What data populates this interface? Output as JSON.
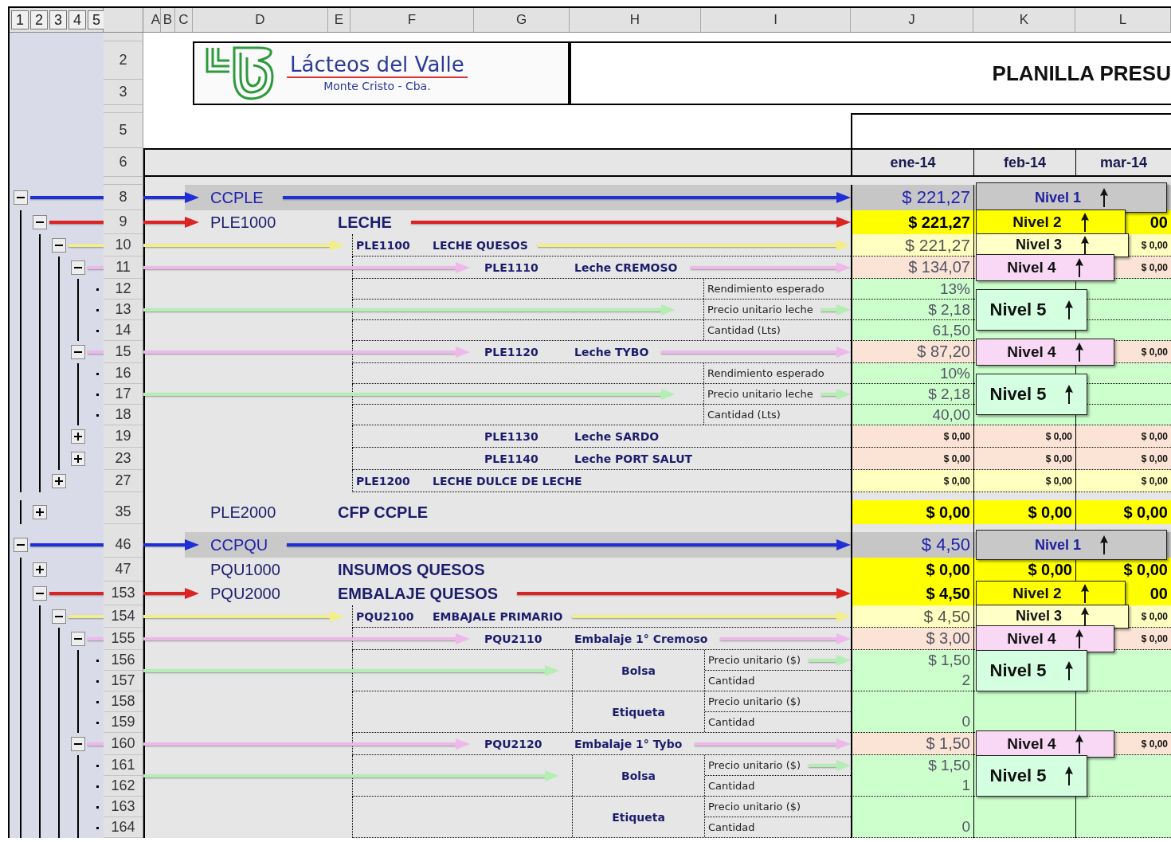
{
  "outline_levels": [
    "1",
    "2",
    "3",
    "4",
    "5"
  ],
  "columns": [
    "A",
    "B",
    "C",
    "D",
    "E",
    "F",
    "G",
    "H",
    "I",
    "J",
    "K",
    "L"
  ],
  "top_row_numbers": [
    "2",
    "3",
    "5",
    "6"
  ],
  "logo": {
    "name": "Lácteos del Valle",
    "place": "Monte Cristo - Cba."
  },
  "title": "PLANILLA PRESU",
  "months": [
    "ene-14",
    "feb-14",
    "mar-14"
  ],
  "rows": [
    {
      "kind": "total",
      "row": "8",
      "expanded": true,
      "arrow": true,
      "code": "CCPLE",
      "cells": {
        "J": "$ 221,27"
      },
      "note": "Nivel 1"
    },
    {
      "kind": "group",
      "row": "9",
      "expanded": true,
      "arrow": true,
      "code": "PLE1000",
      "name": "LECHE",
      "cells": {
        "J": "$ 221,27",
        "L": "00"
      },
      "note": "Nivel 2"
    },
    {
      "kind": "subgroup",
      "row": "10",
      "expanded": true,
      "arrow": true,
      "code": "PLE1100",
      "name": "LECHE QUESOS",
      "cells": {
        "J": "$ 221,27",
        "L": "$ 0,00"
      },
      "note": "Nivel 3"
    },
    {
      "kind": "item",
      "row": "11",
      "expanded": true,
      "arrow": true,
      "code": "PLE1110",
      "name": "Leche CREMOSO",
      "cells": {
        "J": "$ 134,07",
        "L": "$ 0,00"
      },
      "note": "Nivel 4"
    },
    {
      "kind": "detail",
      "row": "12",
      "arrow": false,
      "label": "Rendimiento esperado",
      "cells": {
        "J": "13%"
      }
    },
    {
      "kind": "detail",
      "row": "13",
      "arrow": true,
      "label": "Precio unitario leche",
      "cells": {
        "J": "$ 2,18"
      },
      "note": "Nivel 5"
    },
    {
      "kind": "detail",
      "row": "14",
      "arrow": false,
      "label": "Cantidad (Lts)",
      "cells": {
        "J": "61,50"
      }
    },
    {
      "kind": "item",
      "row": "15",
      "expanded": true,
      "arrow": true,
      "code": "PLE1120",
      "name": "Leche TYBO",
      "cells": {
        "J": "$ 87,20",
        "L": "$ 0,00"
      },
      "note": "Nivel 4"
    },
    {
      "kind": "detail",
      "row": "16",
      "arrow": false,
      "label": "Rendimiento esperado",
      "cells": {
        "J": "10%"
      }
    },
    {
      "kind": "detail",
      "row": "17",
      "arrow": true,
      "label": "Precio unitario leche",
      "cells": {
        "J": "$ 2,18"
      },
      "note": "Nivel 5"
    },
    {
      "kind": "detail",
      "row": "18",
      "arrow": false,
      "label": "Cantidad (Lts)",
      "cells": {
        "J": "40,00"
      }
    },
    {
      "kind": "item",
      "row": "19",
      "expanded": false,
      "arrow": false,
      "code": "PLE1130",
      "name": "Leche SARDO",
      "cells": {
        "J": "$ 0,00",
        "K": "$ 0,00",
        "L": "$ 0,00"
      }
    },
    {
      "kind": "item",
      "row": "23",
      "expanded": false,
      "arrow": false,
      "code": "PLE1140",
      "name": "Leche PORT SALUT",
      "cells": {
        "J": "$ 0,00",
        "K": "$ 0,00",
        "L": "$ 0,00"
      }
    },
    {
      "kind": "subgroup",
      "row": "27",
      "expanded": false,
      "arrow": false,
      "code": "PLE1200",
      "name": "LECHE DULCE DE LECHE",
      "cells": {
        "J": "$ 0,00",
        "K": "$ 0,00",
        "L": "$ 0,00"
      }
    },
    {
      "kind": "hidden"
    },
    {
      "kind": "group",
      "row": "35",
      "expanded": false,
      "arrow": false,
      "code": "PLE2000",
      "name": "CFP CCPLE",
      "cells": {
        "J": "$ 0,00",
        "K": "$ 0,00",
        "L": "$ 0,00"
      }
    },
    {
      "kind": "hidden"
    },
    {
      "kind": "total",
      "row": "46",
      "expanded": true,
      "arrow": true,
      "code": "CCPQU",
      "cells": {
        "J": "$ 4,50"
      },
      "note": "Nivel 1"
    },
    {
      "kind": "group",
      "row": "47",
      "expanded": false,
      "arrow": false,
      "code": "PQU1000",
      "name": "INSUMOS QUESOS",
      "cells": {
        "J": "$ 0,00",
        "K": "$ 0,00",
        "L": "$ 0,00"
      }
    },
    {
      "kind": "group",
      "row": "153",
      "expanded": true,
      "arrow": true,
      "code": "PQU2000",
      "name": "EMBALAJE QUESOS",
      "cells": {
        "J": "$ 4,50",
        "L": "00"
      },
      "note": "Nivel 2"
    },
    {
      "kind": "subgroup",
      "row": "154",
      "expanded": true,
      "arrow": true,
      "code": "PQU2100",
      "name": "EMBAJALE PRIMARIO",
      "cells": {
        "J": "$ 4,50",
        "L": "$ 0,00"
      },
      "note": "Nivel 3"
    },
    {
      "kind": "item",
      "row": "155",
      "expanded": true,
      "arrow": true,
      "code": "PQU2110",
      "name": "Embalaje 1° Cremoso",
      "cells": {
        "J": "$ 3,00",
        "L": "$ 0,00"
      },
      "note": "Nivel 4"
    },
    {
      "kind": "pair",
      "label": "Bolsa",
      "arrow": true,
      "note": "Nivel 5",
      "lines": [
        {
          "row": "156",
          "label": "Precio unitario ($)",
          "cells": {
            "J": "$ 1,50"
          }
        },
        {
          "row": "157",
          "label": "Cantidad",
          "cells": {
            "J": "2"
          }
        }
      ]
    },
    {
      "kind": "pair",
      "label": "Etiqueta",
      "arrow": false,
      "lines": [
        {
          "row": "158",
          "label": "Precio unitario ($)"
        },
        {
          "row": "159",
          "label": "Cantidad",
          "cells": {
            "J": "0"
          }
        }
      ]
    },
    {
      "kind": "item",
      "row": "160",
      "expanded": true,
      "arrow": true,
      "code": "PQU2120",
      "name": "Embalaje 1° Tybo",
      "cells": {
        "J": "$ 1,50",
        "L": "$ 0,00"
      },
      "note": "Nivel 4"
    },
    {
      "kind": "pair",
      "label": "Bolsa",
      "arrow": true,
      "note": "Nivel 5",
      "lines": [
        {
          "row": "161",
          "label": "Precio unitario ($)",
          "cells": {
            "J": "$ 1,50"
          }
        },
        {
          "row": "162",
          "label": "Cantidad",
          "cells": {
            "J": "1"
          }
        }
      ]
    },
    {
      "kind": "pair",
      "label": "Etiqueta",
      "arrow": false,
      "lines": [
        {
          "row": "163",
          "label": "Precio unitario ($)"
        },
        {
          "row": "164",
          "label": "Cantidad",
          "cells": {
            "J": "0"
          }
        }
      ]
    }
  ]
}
